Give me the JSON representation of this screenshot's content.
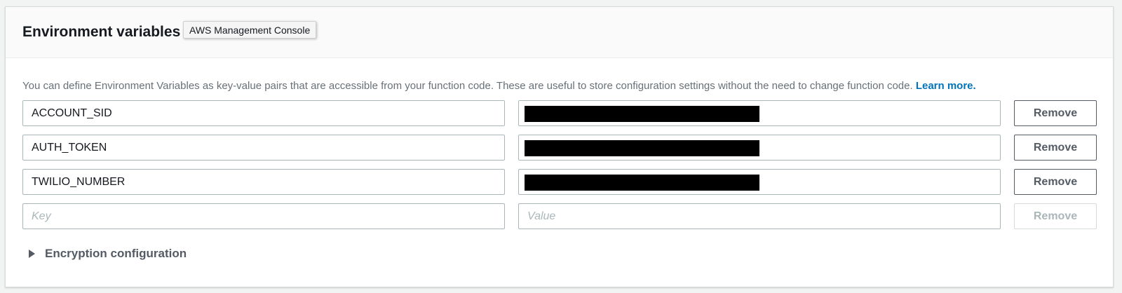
{
  "panel": {
    "title": "Environment variables",
    "tooltip": "AWS Management Console",
    "description": "You can define Environment Variables as key-value pairs that are accessible from your function code. These are useful to store configuration settings without the need to change function code.",
    "learn_more": "Learn more."
  },
  "variables": [
    {
      "key": "ACCOUNT_SID",
      "value_redacted": true,
      "remove_label": "Remove"
    },
    {
      "key": "AUTH_TOKEN",
      "value_redacted": true,
      "remove_label": "Remove"
    },
    {
      "key": "TWILIO_NUMBER",
      "value_redacted": true,
      "remove_label": "Remove"
    }
  ],
  "new_row": {
    "key_placeholder": "Key",
    "value_placeholder": "Value",
    "remove_label": "Remove",
    "remove_disabled": true
  },
  "encryption": {
    "label": "Encryption configuration",
    "expanded": false
  },
  "colors": {
    "link": "#0073bb",
    "redaction": "#000000",
    "border": "#aab7b8"
  }
}
